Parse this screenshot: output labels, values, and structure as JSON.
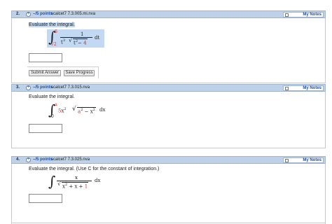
{
  "questions": [
    {
      "number": "2.",
      "points": "–/5 points",
      "source": "scalcet7 7.3.005.mi.nva",
      "notes_label": "My Notes",
      "prompt": "Evaluate the integral.",
      "integral": {
        "upper": "6",
        "lower": "√2",
        "num": "1",
        "den_a": "t",
        "den_a_exp": "3",
        "den_rad": "t",
        "den_rad_exp": "2",
        "den_rad_minus": "− ",
        "den_rad_const": "4",
        "diff": "dt"
      },
      "buttons": {
        "submit": "Submit Answer",
        "save": "Save Progress"
      }
    },
    {
      "number": "3.",
      "points": "–/5 points",
      "source": "scalcet7 7.3.015.nva",
      "notes_label": "My Notes",
      "prompt": "Evaluate the integral.",
      "integral": {
        "upper": "a",
        "lower": "0",
        "coef": "5",
        "var": "x",
        "var_exp": "2",
        "rad_a": "a",
        "rad_a_exp": "2",
        "rad_minus": " − ",
        "rad_x": "x",
        "rad_x_exp": "2",
        "diff": "dx"
      }
    },
    {
      "number": "4.",
      "points": "–/5 points",
      "source": "scalcet7 7.3.025.nva",
      "notes_label": "My Notes",
      "prompt": "Evaluate the integral. (Use C for the constant of integration.)",
      "integral": {
        "num": "x",
        "rad_x": "x",
        "rad_x_exp": "2",
        "rad_plus": " + x + ",
        "rad_const": "1",
        "diff": "dx"
      }
    }
  ]
}
